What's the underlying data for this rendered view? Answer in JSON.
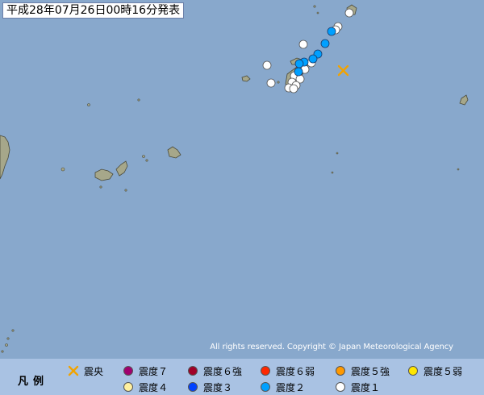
{
  "header": {
    "title": "平成28年07月26日00時16分発表"
  },
  "copyright": "All rights reserved. Copyright © Japan Meteorological Agency",
  "colors": {
    "sea": "#88a8cc",
    "land": "#a6a78a",
    "legend_bg": "#a9c2e3",
    "epicenter": "#f2a300",
    "shindo7": "#a0006e",
    "shindo6_strong": "#a00028",
    "shindo6_weak": "#ff2800",
    "shindo5_strong": "#ff9900",
    "shindo5_weak": "#ffe600",
    "shindo4": "#fff0a0",
    "shindo3": "#0041ff",
    "shindo2": "#00a0ff",
    "shindo1": "#ffffff"
  },
  "legend": {
    "title": "凡例",
    "items": [
      {
        "key": "epicenter",
        "label": "震央",
        "symbol": "cross",
        "color": "#f2a300"
      },
      {
        "key": "shindo7",
        "label": "震度７",
        "symbol": "dot",
        "color": "#a0006e"
      },
      {
        "key": "shindo6_strong",
        "label": "震度６強",
        "symbol": "dot",
        "color": "#a00028"
      },
      {
        "key": "shindo6_weak",
        "label": "震度６弱",
        "symbol": "dot",
        "color": "#ff2800"
      },
      {
        "key": "shindo5_strong",
        "label": "震度５強",
        "symbol": "dot",
        "color": "#ff9900"
      },
      {
        "key": "shindo5_weak",
        "label": "震度５弱",
        "symbol": "dot",
        "color": "#ffe600"
      },
      {
        "key": "shindo4",
        "label": "震度４",
        "symbol": "dot",
        "color": "#fff0a0"
      },
      {
        "key": "shindo3",
        "label": "震度３",
        "symbol": "dot",
        "color": "#0041ff"
      },
      {
        "key": "shindo2",
        "label": "震度２",
        "symbol": "dot",
        "color": "#00a0ff"
      },
      {
        "key": "shindo1",
        "label": "震度１",
        "symbol": "dot",
        "color": "#ffffff"
      }
    ]
  }
}
